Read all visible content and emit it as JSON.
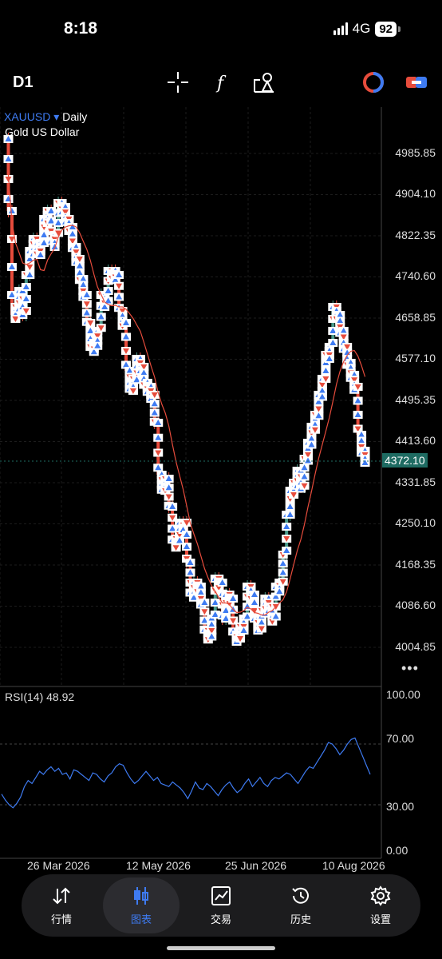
{
  "status_bar": {
    "time": "8:18",
    "network": "4G",
    "battery": "92"
  },
  "toolbar": {
    "timeframe": "D1",
    "tools": [
      "crosshair-icon",
      "function-icon",
      "objects-icon",
      "trade-icon",
      "link-icon"
    ]
  },
  "chart": {
    "symbol": "XAUUSD",
    "symbol_arrow": "▾",
    "period": "Daily",
    "description": "Gold US Dollar",
    "current_price": "4372.10",
    "more": "•••",
    "colors": {
      "bull": "#4a9a8a",
      "bear": "#e74c3c",
      "ma": "#e74c3c",
      "rsi": "#3e7bf2",
      "price_line": "#1e6b62"
    }
  },
  "price_axis": [
    "4985.85",
    "4904.10",
    "4822.35",
    "4740.60",
    "4658.85",
    "4577.10",
    "4495.35",
    "4413.60",
    "4331.85",
    "4250.10",
    "4168.35",
    "4086.60",
    "4004.85"
  ],
  "rsi": {
    "label": "RSI(14) 48.92",
    "levels": [
      "100.00",
      "70.00",
      "30.00",
      "0.00"
    ]
  },
  "date_axis": [
    "26 Mar 2026",
    "12 May 2026",
    "25 Jun 2026",
    "10 Aug 2026"
  ],
  "chart_data": {
    "type": "line",
    "title": "XAUUSD Daily",
    "series": [
      {
        "name": "RSI(14) 48.92",
        "values": [
          37,
          33,
          30,
          28,
          31,
          35,
          42,
          46,
          44,
          48,
          52,
          50,
          53,
          55,
          52,
          54,
          50,
          51,
          47,
          53,
          52,
          50,
          48,
          46,
          51,
          50,
          47,
          45,
          49,
          51,
          55,
          57,
          56,
          51,
          47,
          44,
          46,
          49,
          52,
          49,
          46,
          48,
          44,
          43,
          42,
          45,
          43,
          41,
          38,
          34,
          39,
          45,
          41,
          40,
          44,
          42,
          39,
          36,
          40,
          43,
          45,
          41,
          38,
          40,
          44,
          47,
          42,
          45,
          48,
          44,
          42,
          46,
          48,
          47,
          49,
          51,
          50,
          47,
          44,
          48,
          52,
          55,
          54,
          58,
          62,
          66,
          71,
          70,
          67,
          63,
          66,
          70,
          73,
          74,
          68,
          62,
          56,
          50
        ]
      }
    ],
    "ylim": [
      0,
      100
    ]
  },
  "nav": [
    {
      "label": "行情",
      "icon": "quotes-icon"
    },
    {
      "label": "图表",
      "icon": "chart-icon",
      "active": true
    },
    {
      "label": "交易",
      "icon": "trade-chart-icon"
    },
    {
      "label": "历史",
      "icon": "history-icon"
    },
    {
      "label": "设置",
      "icon": "settings-icon"
    }
  ]
}
